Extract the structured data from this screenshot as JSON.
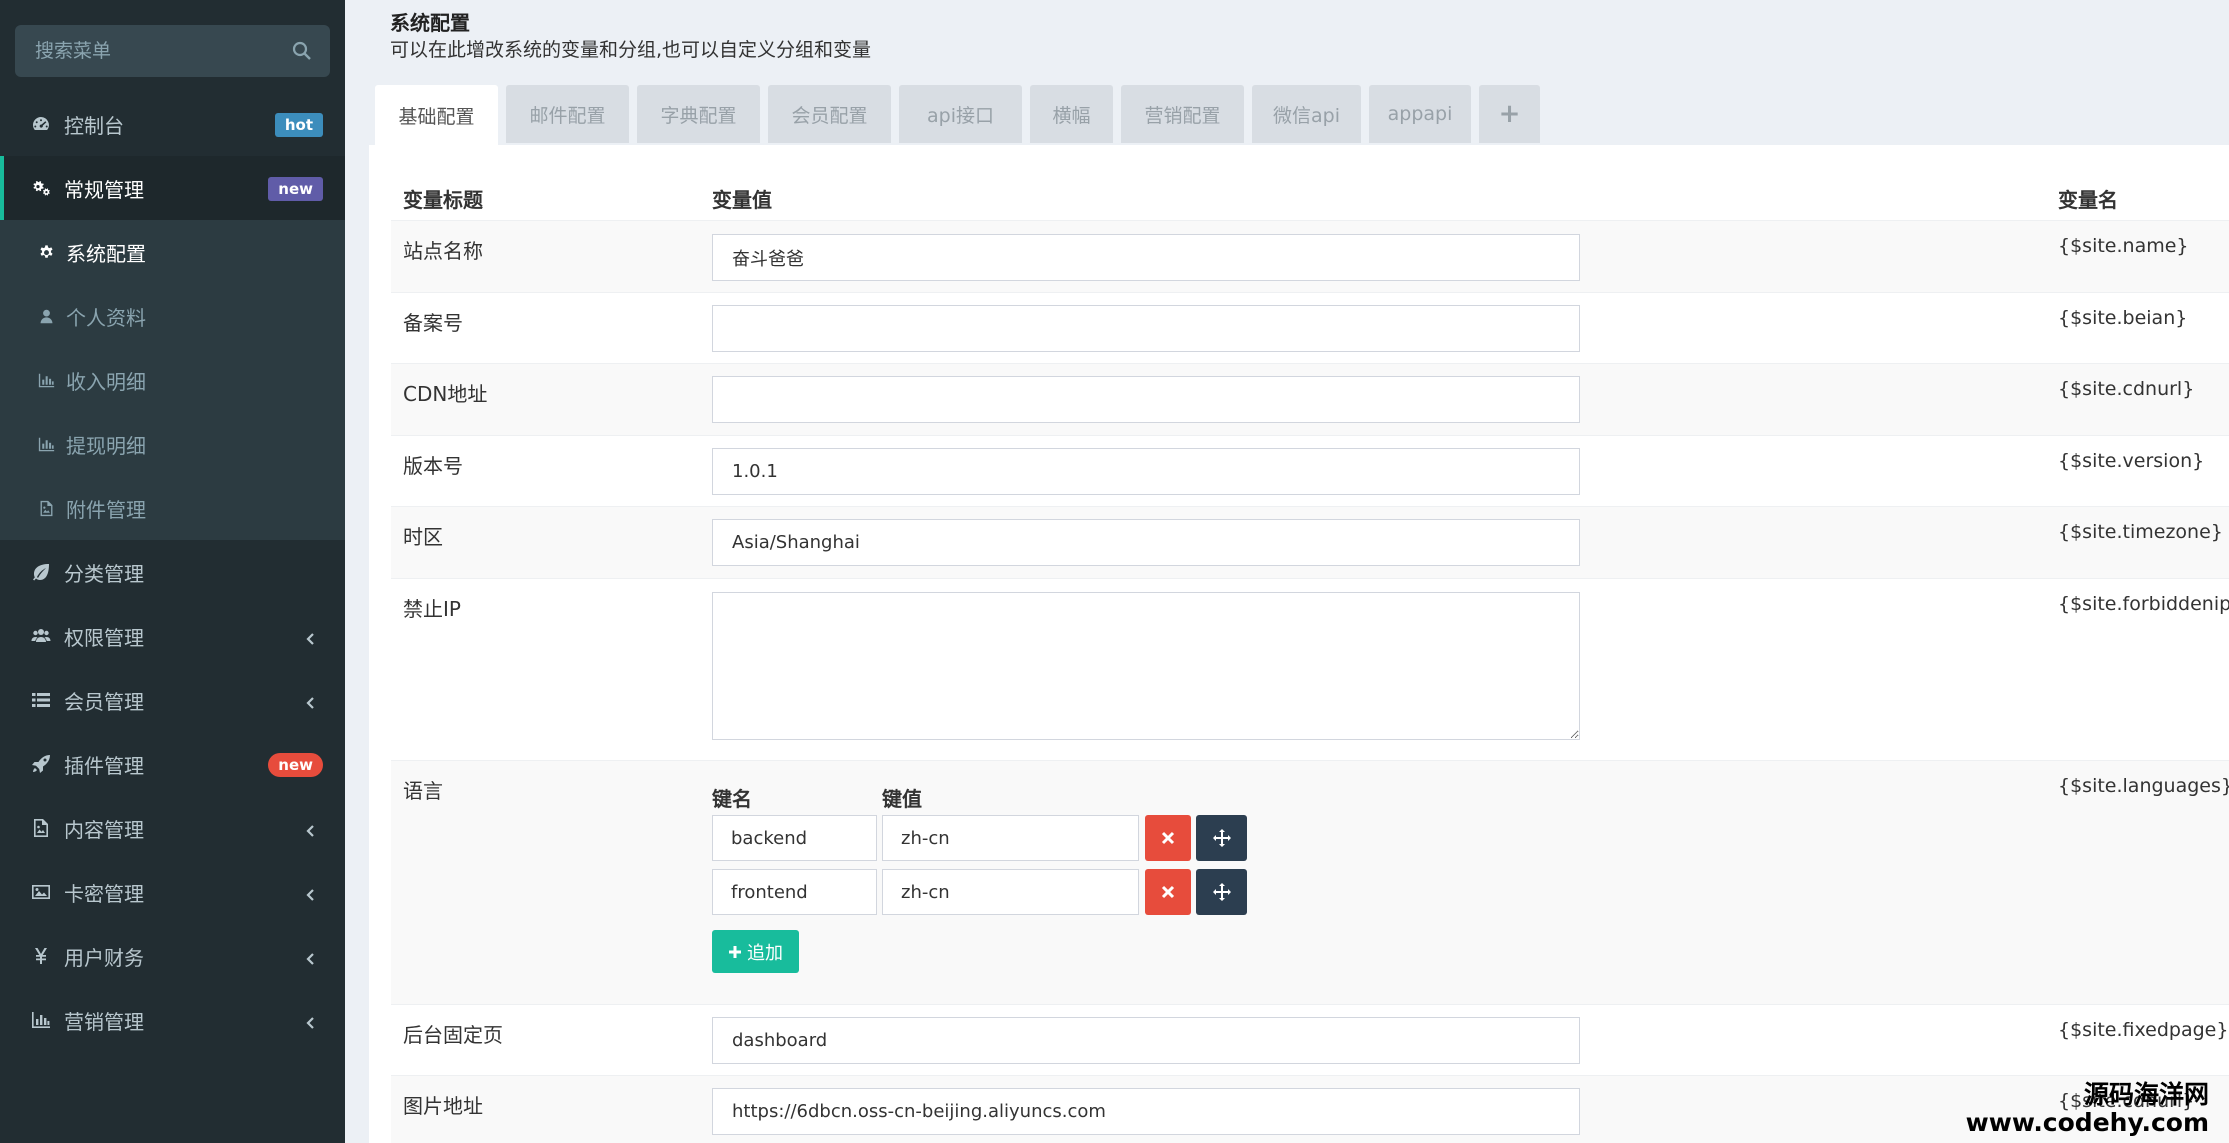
{
  "sidebar": {
    "search_placeholder": "搜索菜单",
    "menu": [
      {
        "label": "控制台",
        "icon": "dashboard-icon",
        "badge": "hot"
      },
      {
        "label": "常规管理",
        "icon": "cogs-icon",
        "badge": "new"
      },
      {
        "label": "分类管理",
        "icon": "leaf-icon"
      },
      {
        "label": "权限管理",
        "icon": "users-icon"
      },
      {
        "label": "会员管理",
        "icon": "list-icon"
      },
      {
        "label": "插件管理",
        "icon": "rocket-icon",
        "badge": "new"
      },
      {
        "label": "内容管理",
        "icon": "file-image-icon"
      },
      {
        "label": "卡密管理",
        "icon": "image-icon"
      },
      {
        "label": "用户财务",
        "icon": "yen-icon"
      },
      {
        "label": "营销管理",
        "icon": "bar-chart-icon"
      }
    ],
    "submenu": [
      {
        "label": "系统配置",
        "icon": "gear-icon"
      },
      {
        "label": "个人资料",
        "icon": "user-icon"
      },
      {
        "label": "收入明细",
        "icon": "bar-chart-icon"
      },
      {
        "label": "提现明细",
        "icon": "bar-chart-icon"
      },
      {
        "label": "附件管理",
        "icon": "file-image-icon"
      }
    ]
  },
  "header": {
    "title": "系统配置",
    "description": "可以在此增改系统的变量和分组,也可以自定义分组和变量"
  },
  "tabs": [
    "基础配置",
    "邮件配置",
    "字典配置",
    "会员配置",
    "api接口",
    "横幅",
    "营销配置",
    "微信api",
    "appapi",
    "+"
  ],
  "table": {
    "headers": {
      "title": "变量标题",
      "value": "变量值",
      "name": "变量名"
    },
    "rows": [
      {
        "label": "站点名称",
        "value": "奋斗爸爸",
        "var": "{$site.name}"
      },
      {
        "label": "备案号",
        "value": "",
        "var": "{$site.beian}"
      },
      {
        "label": "CDN地址",
        "value": "",
        "var": "{$site.cdnurl}"
      },
      {
        "label": "版本号",
        "value": "1.0.1",
        "var": "{$site.version}"
      },
      {
        "label": "时区",
        "value": "Asia/Shanghai",
        "var": "{$site.timezone}"
      },
      {
        "label": "禁止IP",
        "value": "",
        "var": "{$site.forbiddenip}"
      },
      {
        "label": "语言",
        "var": "{$site.languages}"
      },
      {
        "label": "后台固定页",
        "value": "dashboard",
        "var": "{$site.fixedpage}"
      },
      {
        "label": "图片地址",
        "value": "https://6dbcn.oss-cn-beijing.aliyuncs.com",
        "var": "{$site.cdnurl}"
      }
    ],
    "languages": {
      "key_header": "键名",
      "value_header": "键值",
      "pairs": [
        {
          "key": "backend",
          "value": "zh-cn"
        },
        {
          "key": "frontend",
          "value": "zh-cn"
        }
      ],
      "add_label": "追加"
    }
  },
  "watermark": {
    "line1": "源码海洋网",
    "line2": "www.codehy.com"
  },
  "colors": {
    "sidebar_bg": "#222d32",
    "accent": "#18bc9c",
    "danger": "#e74c3c",
    "dark_button": "#2c3e50",
    "badge_hot": "#3c8dbc",
    "badge_new": "#605ca8"
  }
}
